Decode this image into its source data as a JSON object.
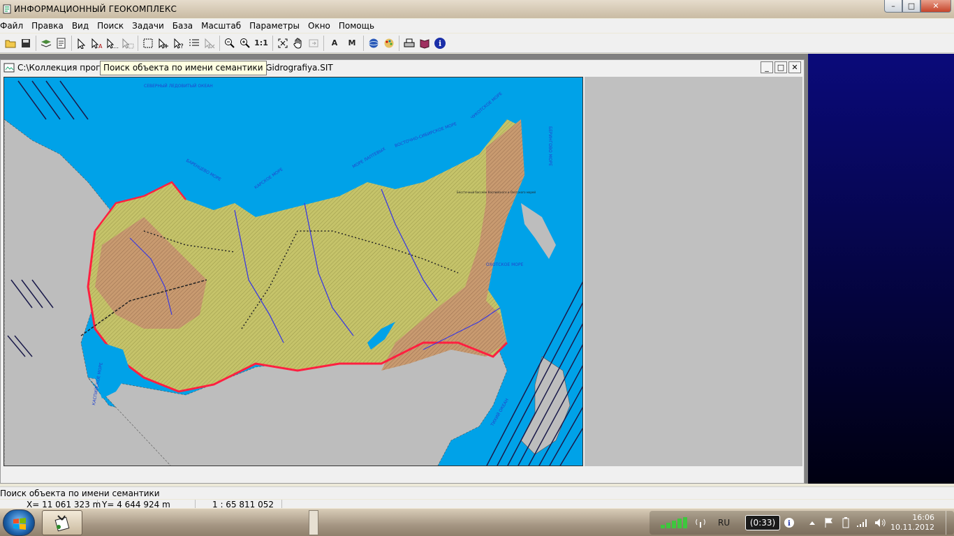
{
  "window": {
    "title": "ИНФОРМАЦИОННЫЙ ГЕОКОМПЛЕКС",
    "controls": {
      "minimize": "–",
      "maximize": "□",
      "close": "✕"
    }
  },
  "menu": [
    "Файл",
    "Правка",
    "Вид",
    "Поиск",
    "Задачи",
    "База",
    "Масштаб",
    "Параметры",
    "Окно",
    "Помощь"
  ],
  "toolbar": {
    "scale_label": "1:1",
    "label_a": "A",
    "label_m": "M"
  },
  "document": {
    "path": "C:\\Коллекция прогр...атические\\Природа\\Гидрография\\Gidrografiya.SIT",
    "controls": {
      "minimize": "_",
      "maximize": "□",
      "close": "✕"
    }
  },
  "tooltip": "Поиск объекта по имени семантики",
  "map": {
    "sea_labels": [
      "СЕВЕРНЫЙ ЛЕДОВИТЫЙ ОКЕАН",
      "БАРЕНЦЕВО МОРЕ",
      "КАРСКОЕ МОРЕ",
      "МОРЕ ЛАПТЕВЫХ",
      "ВОСТОЧНО-СИБИРСКОЕ МОРЕ",
      "ЧУКОТСКОЕ МОРЕ",
      "БЕРИНГОВО МОРЕ",
      "ОХОТСКОЕ МОРЕ",
      "ТИХИЙ ОКЕАН",
      "КАСПИЙСКОЕ МОРЕ"
    ],
    "annotation": "Бессточный бассейн Каспийского и Охотского морей",
    "colors": {
      "sea": "#00a2e8",
      "land": "#bdbdbd",
      "basin_yellow": "#c5c36a",
      "basin_brown": "#c89a70",
      "border": "#ff2040",
      "rivers": "#3a3ae0"
    }
  },
  "status": {
    "hint": "Поиск объекта по имени семантики",
    "x": "X=  11 061 323 m",
    "y": "Y=  4 644 924 m",
    "scale": "1 : 65 811 052"
  },
  "taskbar": {
    "lang": "RU",
    "battery": "(0:33)",
    "time": "16:06",
    "date": "10.11.2012"
  }
}
